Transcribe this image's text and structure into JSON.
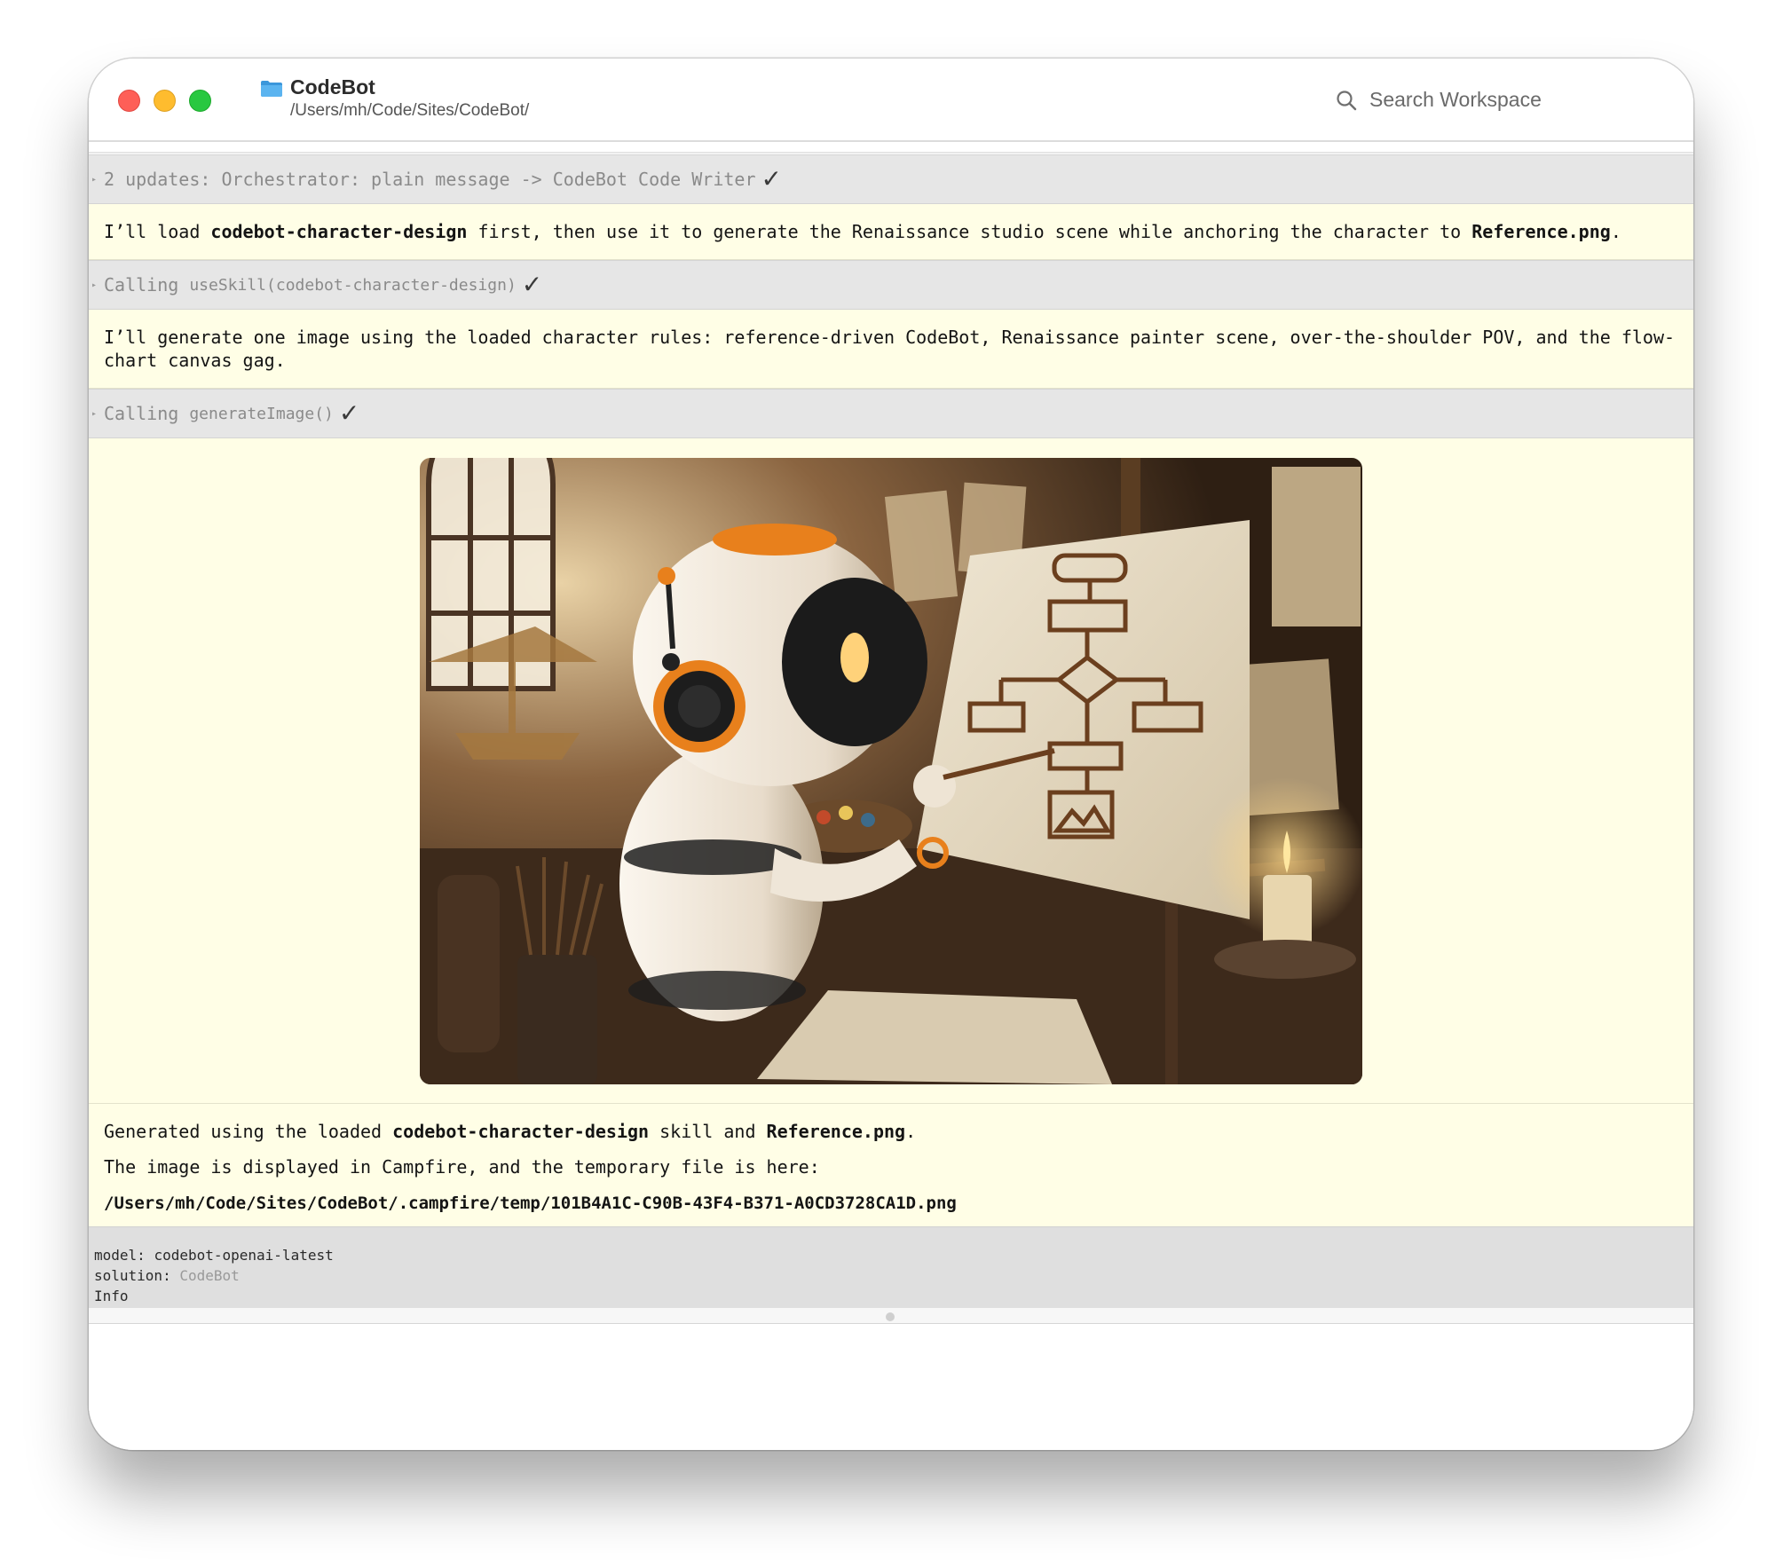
{
  "window": {
    "title": "CodeBot",
    "path": "/Users/mh/Code/Sites/CodeBot/",
    "search_placeholder": "Search Workspace"
  },
  "transcript": {
    "updates_row": {
      "text": "2 updates: Orchestrator: plain message -> CodeBot Code Writer",
      "check": "✓"
    },
    "message1": {
      "part1": "I’ll load ",
      "skill": "codebot-character-design",
      "part2": " first, then use it to generate the Renaissance studio scene while anchoring the character to ",
      "reference": "Reference.png",
      "part3": "."
    },
    "tool_call1": {
      "prefix": "Calling ",
      "call": "useSkill(codebot-character-design)",
      "check": "✓"
    },
    "message2": {
      "text": "I’ll generate one image using the loaded character rules: reference-driven CodeBot, Renaissance painter scene, over-the-shoulder POV, and the flow-chart canvas gag."
    },
    "tool_call2": {
      "prefix": "Calling ",
      "call": "generateImage()",
      "check": "✓"
    },
    "final": {
      "line1_part1": "Generated using the loaded ",
      "line1_skill": "codebot-character-design",
      "line1_part2": " skill and ",
      "line1_reference": "Reference.png",
      "line1_part3": ".",
      "line2": "The image is displayed in Campfire, and the temporary file is here:",
      "line3": "/Users/mh/Code/Sites/CodeBot/.campfire/temp/101B4A1C-C90B-43F4-B371-A0CD3728CA1D.png"
    }
  },
  "status": {
    "model_label": "model:",
    "model_value": "codebot-openai-latest",
    "solution_label": "solution:",
    "solution_value": "CodeBot",
    "info_label": "Info"
  },
  "colors": {
    "message_bg": "#fffee6",
    "tool_row_bg": "#e6e6e6",
    "robot_accent": "#e8801c",
    "folder_blue": "#46a6e8"
  },
  "icons": {
    "folder": "folder-icon",
    "search": "search-icon",
    "check": "checkmark-icon"
  }
}
